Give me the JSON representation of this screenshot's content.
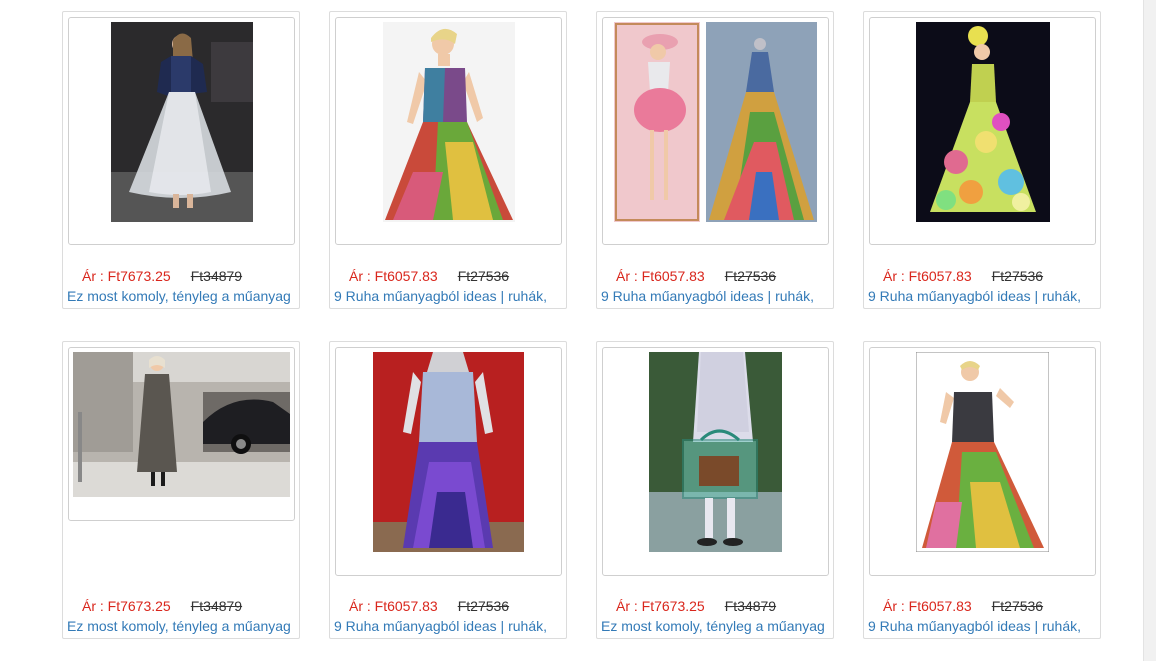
{
  "products": [
    {
      "price": "Ár : Ft7673.25",
      "old_price": "Ft34879",
      "title": "Ez most komoly, tényleg a műanyag",
      "image": "dress-photo"
    },
    {
      "price": "Ár : Ft6057.83",
      "old_price": "Ft27536",
      "title": "9 Ruha műanyagból ideas | ruhák,",
      "image": "dress-photo"
    },
    {
      "price": "Ár : Ft6057.83",
      "old_price": "Ft27536",
      "title": "9 Ruha műanyagból ideas | ruhák,",
      "image": "dress-photo"
    },
    {
      "price": "Ár : Ft6057.83",
      "old_price": "Ft27536",
      "title": "9 Ruha műanyagból ideas | ruhák,",
      "image": "dress-photo"
    },
    {
      "price": "Ár : Ft7673.25",
      "old_price": "Ft34879",
      "title": "Ez most komoly, tényleg a műanyag",
      "image": "coat-photo"
    },
    {
      "price": "Ár : Ft6057.83",
      "old_price": "Ft27536",
      "title": "9 Ruha műanyagból ideas | ruhák,",
      "image": "dress-photo"
    },
    {
      "price": "Ár : Ft7673.25",
      "old_price": "Ft34879",
      "title": "Ez most komoly, tényleg a műanyag",
      "image": "bag-photo"
    },
    {
      "price": "Ár : Ft6057.83",
      "old_price": "Ft27536",
      "title": "9 Ruha műanyagból ideas | ruhák,",
      "image": "dress-photo"
    }
  ]
}
